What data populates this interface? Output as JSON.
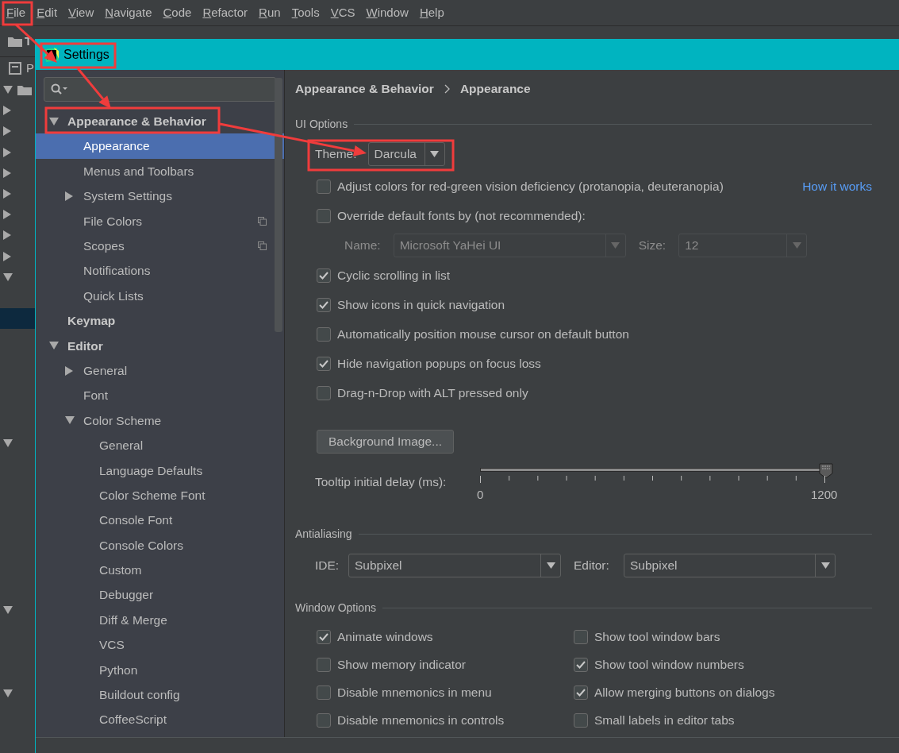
{
  "menu_bar": [
    {
      "label": "File"
    },
    {
      "label": "Edit"
    },
    {
      "label": "View"
    },
    {
      "label": "Navigate"
    },
    {
      "label": "Code"
    },
    {
      "label": "Refactor"
    },
    {
      "label": "Run"
    },
    {
      "label": "Tools"
    },
    {
      "label": "VCS"
    },
    {
      "label": "Window"
    },
    {
      "label": "Help"
    }
  ],
  "ide_background": {
    "breadcrumb": "T",
    "tool_tab": "P",
    "tree_rows": [
      {
        "kind": "node",
        "expanded": true,
        "selected": false
      },
      {
        "kind": "node",
        "expanded": false,
        "selected": false
      },
      {
        "kind": "node",
        "expanded": false,
        "selected": false
      },
      {
        "kind": "node",
        "expanded": false,
        "selected": false
      },
      {
        "kind": "node",
        "expanded": false,
        "selected": false
      },
      {
        "kind": "node",
        "expanded": false,
        "selected": false
      },
      {
        "kind": "node",
        "expanded": false,
        "selected": false
      },
      {
        "kind": "node",
        "expanded": false,
        "selected": false
      },
      {
        "kind": "node",
        "expanded": false,
        "selected": false
      },
      {
        "kind": "node",
        "expanded": true,
        "selected": false
      },
      {
        "kind": "leaf",
        "selected": false
      },
      {
        "kind": "leaf",
        "selected": true
      },
      {
        "kind": "leaf",
        "selected": false
      },
      {
        "kind": "leaf",
        "selected": false
      },
      {
        "kind": "leaf",
        "selected": false
      },
      {
        "kind": "leaf",
        "selected": false
      },
      {
        "kind": "leaf",
        "selected": false
      },
      {
        "kind": "node",
        "expanded": true,
        "selected": false
      },
      {
        "kind": "leaf",
        "selected": false
      },
      {
        "kind": "leaf",
        "selected": false
      },
      {
        "kind": "leaf",
        "selected": false
      },
      {
        "kind": "leaf",
        "selected": false
      },
      {
        "kind": "leaf",
        "selected": false
      },
      {
        "kind": "leaf",
        "selected": false
      },
      {
        "kind": "leaf",
        "selected": false
      },
      {
        "kind": "node",
        "expanded": true,
        "selected": false
      },
      {
        "kind": "leaf",
        "selected": false
      },
      {
        "kind": "leaf",
        "selected": false
      },
      {
        "kind": "leaf",
        "selected": false
      },
      {
        "kind": "node",
        "expanded": true,
        "selected": false
      }
    ]
  },
  "dialog": {
    "title": "Settings",
    "tree": [
      {
        "label": "Appearance & Behavior",
        "expanded": true,
        "selected": false,
        "children": [
          {
            "label": "Appearance",
            "selected": true
          },
          {
            "label": "Menus and Toolbars",
            "selected": false
          },
          {
            "label": "System Settings",
            "expanded": false,
            "selected": false
          },
          {
            "label": "File Colors",
            "selected": false,
            "project_level": true
          },
          {
            "label": "Scopes",
            "selected": false,
            "project_level": true
          },
          {
            "label": "Notifications",
            "selected": false
          },
          {
            "label": "Quick Lists",
            "selected": false
          }
        ]
      },
      {
        "label": "Keymap",
        "selected": false
      },
      {
        "label": "Editor",
        "expanded": true,
        "selected": false,
        "children": [
          {
            "label": "General",
            "expanded": false,
            "selected": false
          },
          {
            "label": "Font",
            "selected": false
          },
          {
            "label": "Color Scheme",
            "expanded": true,
            "selected": false,
            "children": [
              {
                "label": "General",
                "selected": false
              },
              {
                "label": "Language Defaults",
                "selected": false
              },
              {
                "label": "Color Scheme Font",
                "selected": false
              },
              {
                "label": "Console Font",
                "selected": false
              },
              {
                "label": "Console Colors",
                "selected": false
              },
              {
                "label": "Custom",
                "selected": false
              },
              {
                "label": "Debugger",
                "selected": false
              },
              {
                "label": "Diff & Merge",
                "selected": false
              },
              {
                "label": "VCS",
                "selected": false
              },
              {
                "label": "Python",
                "selected": false
              },
              {
                "label": "Buildout config",
                "selected": false
              },
              {
                "label": "CoffeeScript",
                "selected": false
              }
            ]
          }
        ]
      }
    ],
    "breadcrumb": [
      "Appearance & Behavior",
      "Appearance"
    ],
    "ui_options": {
      "title": "UI Options",
      "theme": {
        "label": "Theme:",
        "value": "Darcula"
      },
      "options": [
        {
          "kind": "checkbox",
          "label": "Adjust colors for red-green vision deficiency (protanopia, deuteranopia)",
          "checked": false,
          "link": "How it works"
        },
        {
          "kind": "checkbox",
          "label": "Override default fonts by (not recommended):",
          "checked": false
        },
        {
          "kind": "font_row",
          "disabled": true,
          "name_label": "Name:",
          "name_value": "Microsoft YaHei UI",
          "size_label": "Size:",
          "size_value": "12"
        },
        {
          "kind": "checkbox",
          "label": "Cyclic scrolling in list",
          "checked": true
        },
        {
          "kind": "checkbox",
          "label": "Show icons in quick navigation",
          "checked": true
        },
        {
          "kind": "checkbox",
          "label": "Automatically position mouse cursor on default button",
          "checked": false
        },
        {
          "kind": "checkbox",
          "label": "Hide navigation popups on focus loss",
          "checked": true
        },
        {
          "kind": "checkbox",
          "label": "Drag-n-Drop with ALT pressed only",
          "checked": false
        }
      ],
      "background_button": "Background Image...",
      "tooltip_delay": {
        "label": "Tooltip initial delay (ms):",
        "level": 1,
        "min_label": "0",
        "max_label": "1200"
      }
    },
    "antialiasing": {
      "title": "Antialiasing",
      "ide": {
        "label": "IDE:",
        "value": "Subpixel"
      },
      "editor": {
        "label": "Editor:",
        "value": "Subpixel"
      }
    },
    "window_options": {
      "title": "Window Options",
      "options": [
        {
          "label": "Animate windows",
          "checked": true
        },
        {
          "label": "Show tool window bars",
          "checked": false
        },
        {
          "label": "Show memory indicator",
          "checked": false
        },
        {
          "label": "Show tool window numbers",
          "checked": true
        },
        {
          "label": "Disable mnemonics in menu",
          "checked": false
        },
        {
          "label": "Allow merging buttons on dialogs",
          "checked": true
        },
        {
          "label": "Disable mnemonics in controls",
          "checked": false
        },
        {
          "label": "Small labels in editor tabs",
          "checked": false
        }
      ]
    }
  }
}
